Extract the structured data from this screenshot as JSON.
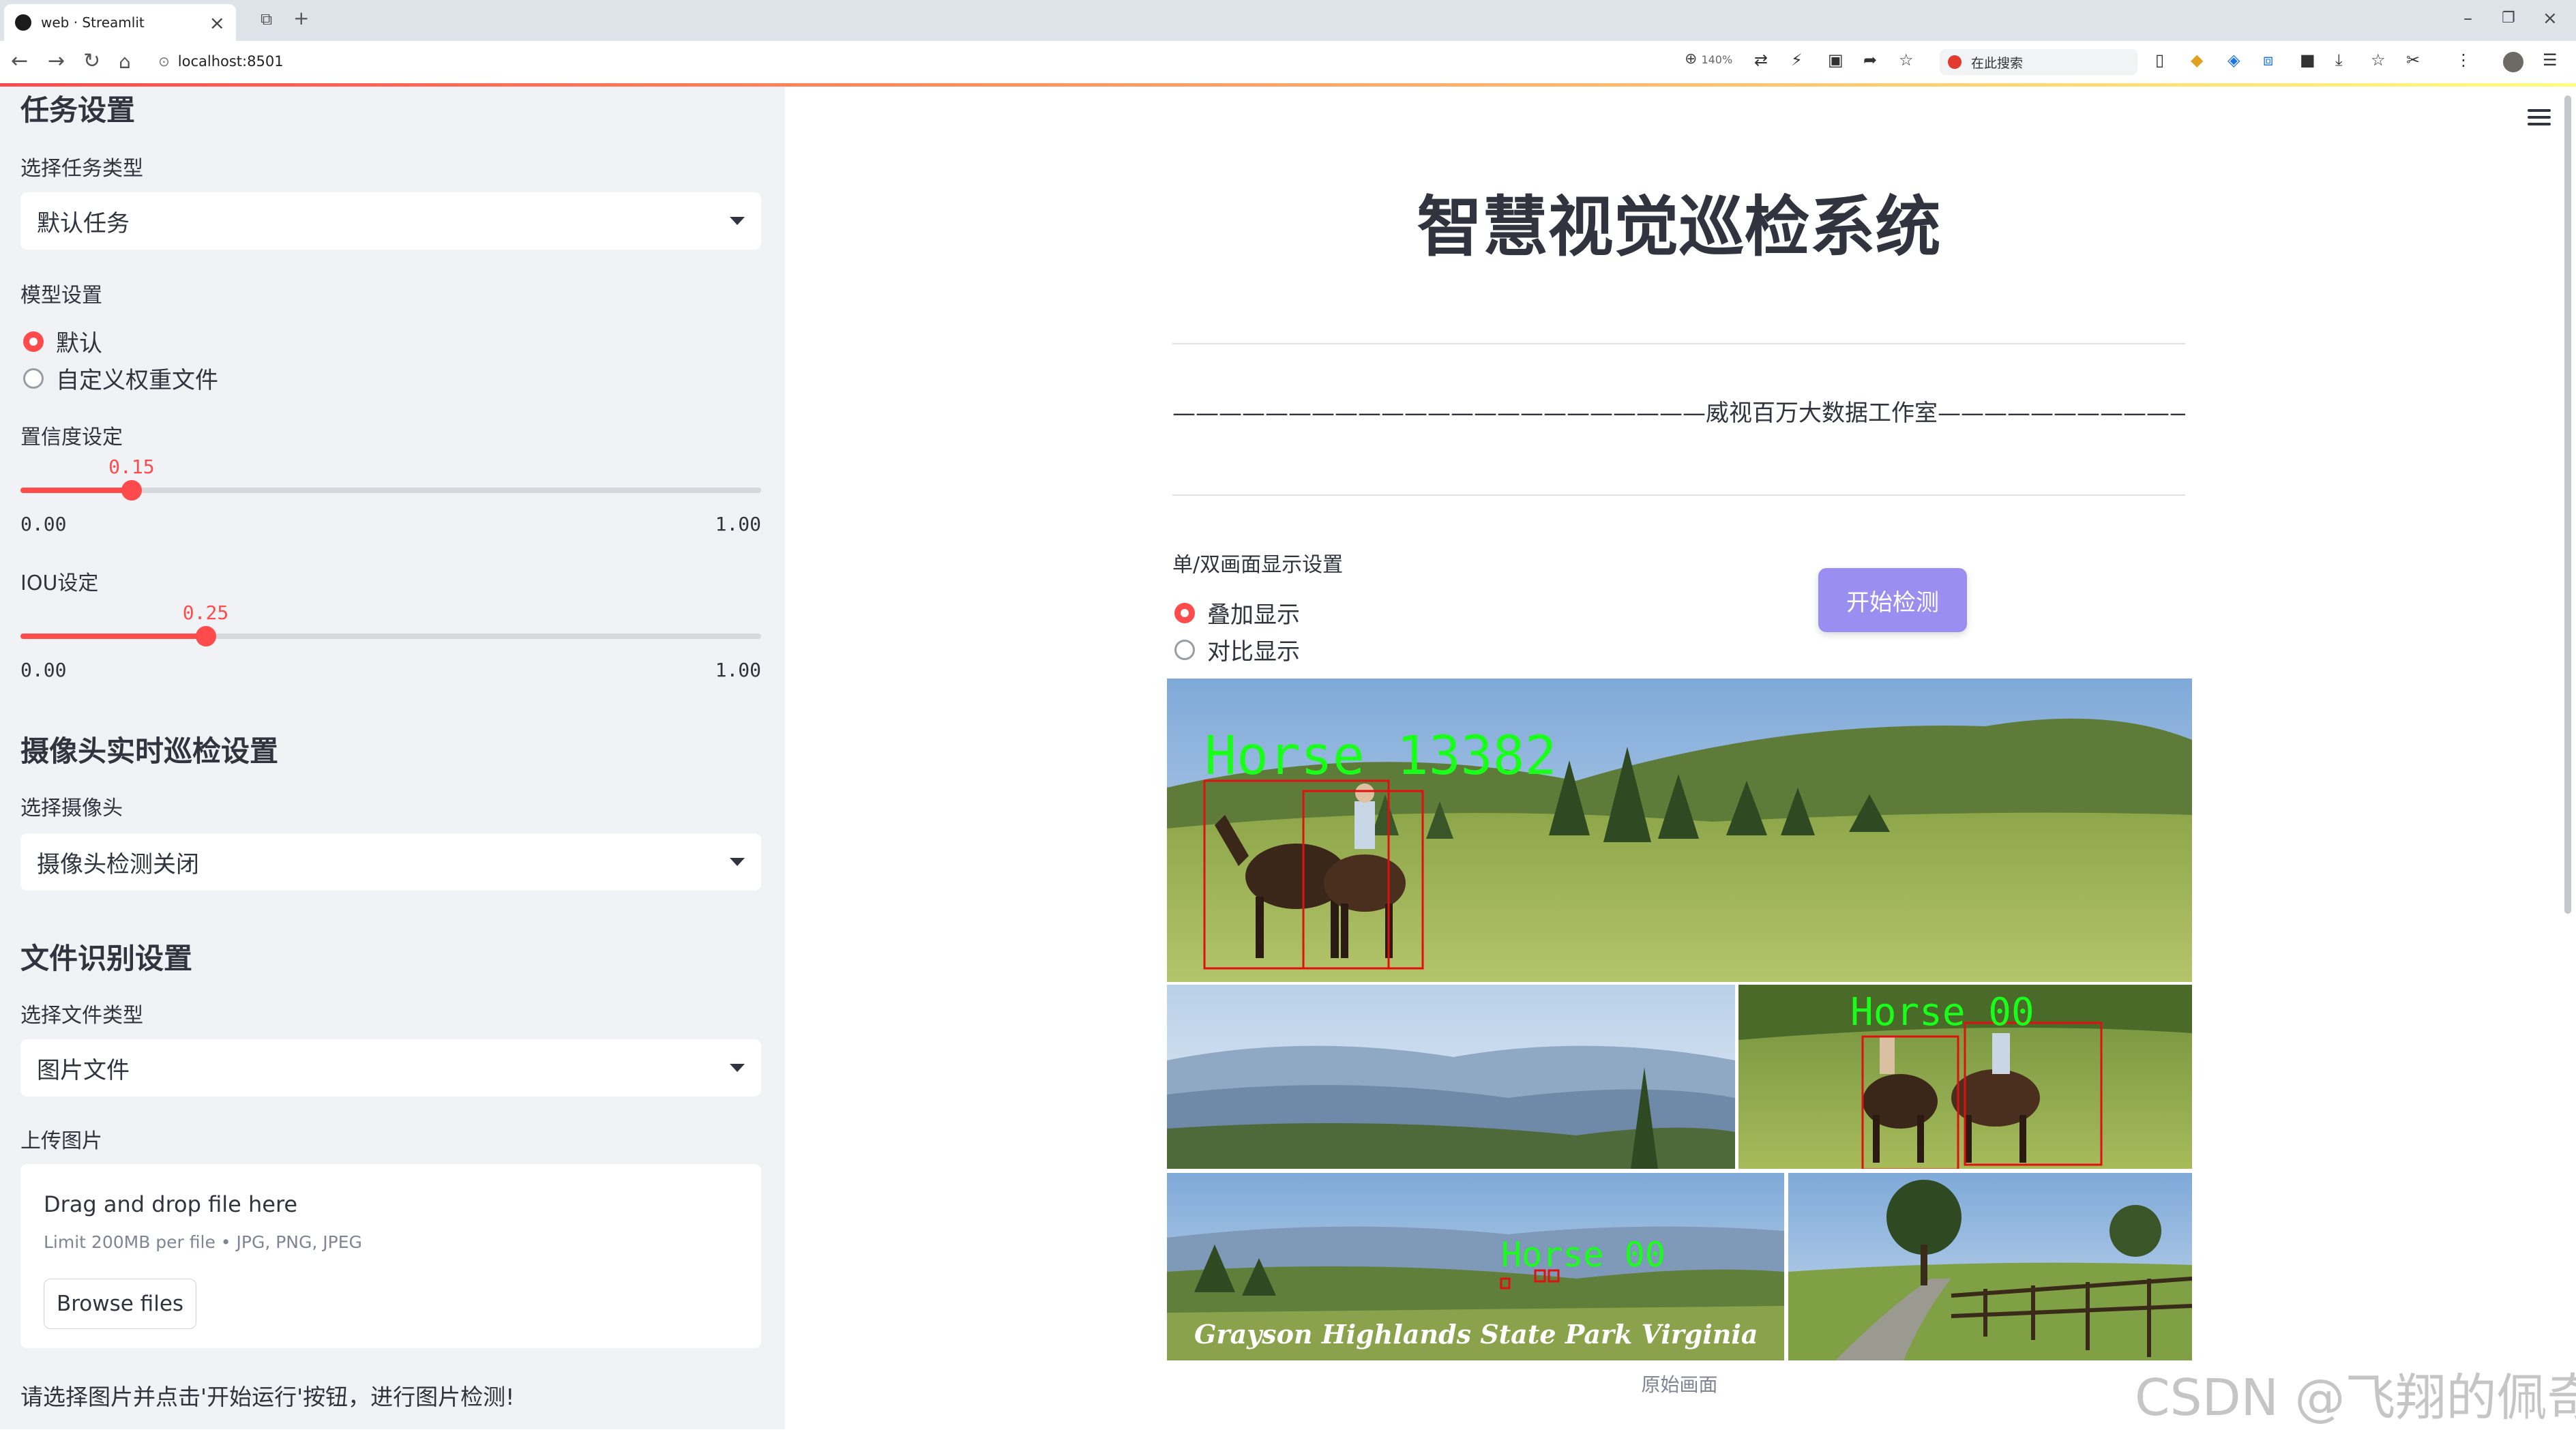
{
  "browser": {
    "tab_title": "web · Streamlit",
    "url": "localhost:8501",
    "zoom": "140%",
    "search_placeholder": "在此搜索"
  },
  "sidebar": {
    "task_heading": "任务设置",
    "task_type_label": "选择任务类型",
    "task_type_value": "默认任务",
    "model_label": "模型设置",
    "model_options": [
      "默认",
      "自定义权重文件"
    ],
    "model_selected": 0,
    "conf_label": "置信度设定",
    "conf_value": 0.15,
    "conf_value_text": "0.15",
    "conf_min": "0.00",
    "conf_max": "1.00",
    "iou_label": "IOU设定",
    "iou_value": 0.25,
    "iou_value_text": "0.25",
    "iou_min": "0.00",
    "iou_max": "1.00",
    "camera_heading": "摄像头实时巡检设置",
    "camera_label": "选择摄像头",
    "camera_value": "摄像头检测关闭",
    "file_heading": "文件识别设置",
    "file_type_label": "选择文件类型",
    "file_type_value": "图片文件",
    "upload_label": "上传图片",
    "upload_drag": "Drag and drop file here",
    "upload_limit": "Limit 200MB per file • JPG, PNG, JPEG",
    "browse_label": "Browse files",
    "hint": "请选择图片并点击'开始运行'按钮，进行图片检测!"
  },
  "main": {
    "title": "智慧视觉巡检系统",
    "subtitle": "———————————————————————威视百万大数据工作室————————————————————————",
    "display_label": "单/双画面显示设置",
    "display_options": [
      "叠加显示",
      "对比显示"
    ],
    "display_selected": 0,
    "start_button": "开始检测",
    "image_caption": "原始画面",
    "image_text": {
      "label1": "Horse 13382",
      "label2": "Horse 00",
      "label3": "Horse 00",
      "park": "Grayson Highlands State Park Virginia"
    }
  },
  "watermark": "CSDN @飞翔的佩奇",
  "colors": {
    "accent": "#ff4b4b",
    "button": "#9a8ff0",
    "sidebar_bg": "#f0f2f6",
    "detect_box": "#e01010",
    "detect_label": "#19ff19"
  }
}
